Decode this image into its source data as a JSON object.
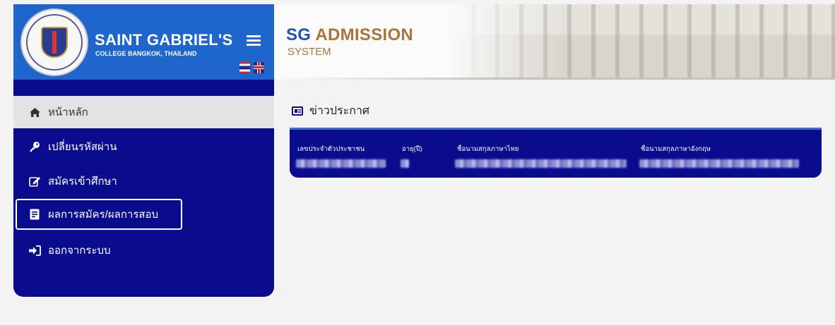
{
  "header": {
    "brand_name": "SAINT GABRIEL'S",
    "brand_sub": "COLLEGE BANGKOK, THAILAND",
    "system_sg": "SG",
    "system_admission": "ADMISSION",
    "system_sub": "SYSTEM"
  },
  "sidebar": {
    "items": [
      {
        "label": "หน้าหลัก",
        "icon": "home-icon"
      },
      {
        "label": "เปลี่ยนรหัสผ่าน",
        "icon": "key-icon"
      },
      {
        "label": "สมัครเข้าศึกษา",
        "icon": "edit-icon"
      },
      {
        "label": "ผลการสมัคร/ผลการสอบ",
        "icon": "document-icon"
      },
      {
        "label": "ออกจากระบบ",
        "icon": "logout-icon"
      }
    ]
  },
  "main": {
    "news_title": "ข่าวประกาศ",
    "table": {
      "columns": [
        "เลขประจำตัวประชาชน",
        "อายุ(ปี)",
        "ชื่อนามสกุลภาษาไทย",
        "ชื่อนามสกุลภาษาอังกฤษ"
      ]
    }
  },
  "colors": {
    "brand_blue": "#1f66cc",
    "navy": "#0b0b8e",
    "gold": "#a8763a"
  }
}
